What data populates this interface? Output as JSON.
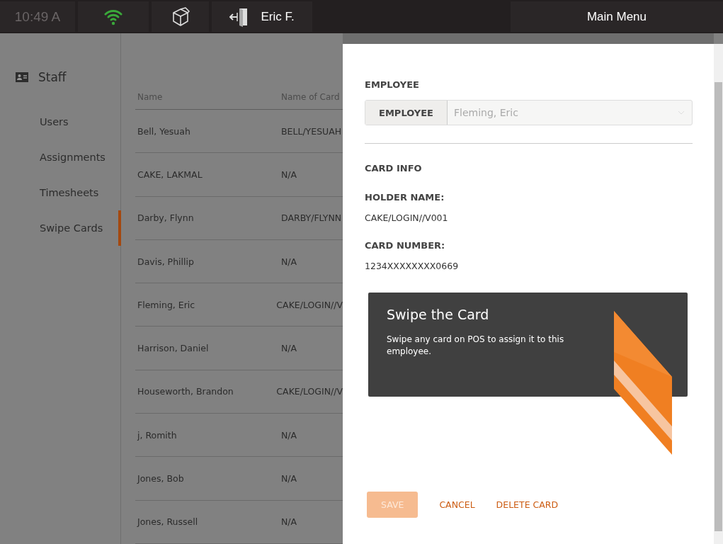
{
  "top_bar": {
    "time": "10:49 A",
    "user": "Eric F.",
    "main_menu": "Main Menu"
  },
  "sidebar": {
    "section": "Staff",
    "items": [
      {
        "label": "Users",
        "selected": false
      },
      {
        "label": "Assignments",
        "selected": false
      },
      {
        "label": "Timesheets",
        "selected": false
      },
      {
        "label": "Swipe Cards",
        "selected": true
      }
    ]
  },
  "table": {
    "columns": [
      "Name",
      "Name of Card"
    ],
    "rows": [
      [
        "Bell, Yesuah",
        "BELL/YESUAH"
      ],
      [
        "CAKE, LAKMAL",
        "N/A"
      ],
      [
        "Darby, Flynn",
        "DARBY/FLYNN"
      ],
      [
        "Davis, Phillip",
        "N/A"
      ],
      [
        "Fleming, Eric",
        "CAKE/LOGIN//V"
      ],
      [
        "Harrison, Daniel",
        "N/A"
      ],
      [
        "Houseworth, Brandon",
        "CAKE/LOGIN//V"
      ],
      [
        "j, Romith",
        "N/A"
      ],
      [
        "Jones, Bob",
        "N/A"
      ],
      [
        "Jones, Russell",
        "N/A"
      ]
    ]
  },
  "dialog": {
    "employee_heading": "EMPLOYEE",
    "employee_field": {
      "label": "EMPLOYEE",
      "value": "Fleming, Eric",
      "disabled": true
    },
    "card_info_heading": "CARD INFO",
    "holder_label": "HOLDER NAME:",
    "holder_value": "CAKE/LOGIN//V001",
    "number_label": "CARD NUMBER:",
    "number_value": "1234XXXXXXXX0669",
    "swipe_panel": {
      "title": "Swipe the Card",
      "text": "Swipe any card on POS to assign it to this employee."
    },
    "buttons": [
      {
        "label": "SAVE",
        "kind": "primary",
        "disabled": true
      },
      {
        "label": "CANCEL",
        "kind": "text",
        "disabled": false
      },
      {
        "label": "DELETE CARD",
        "kind": "text",
        "disabled": false
      }
    ]
  }
}
